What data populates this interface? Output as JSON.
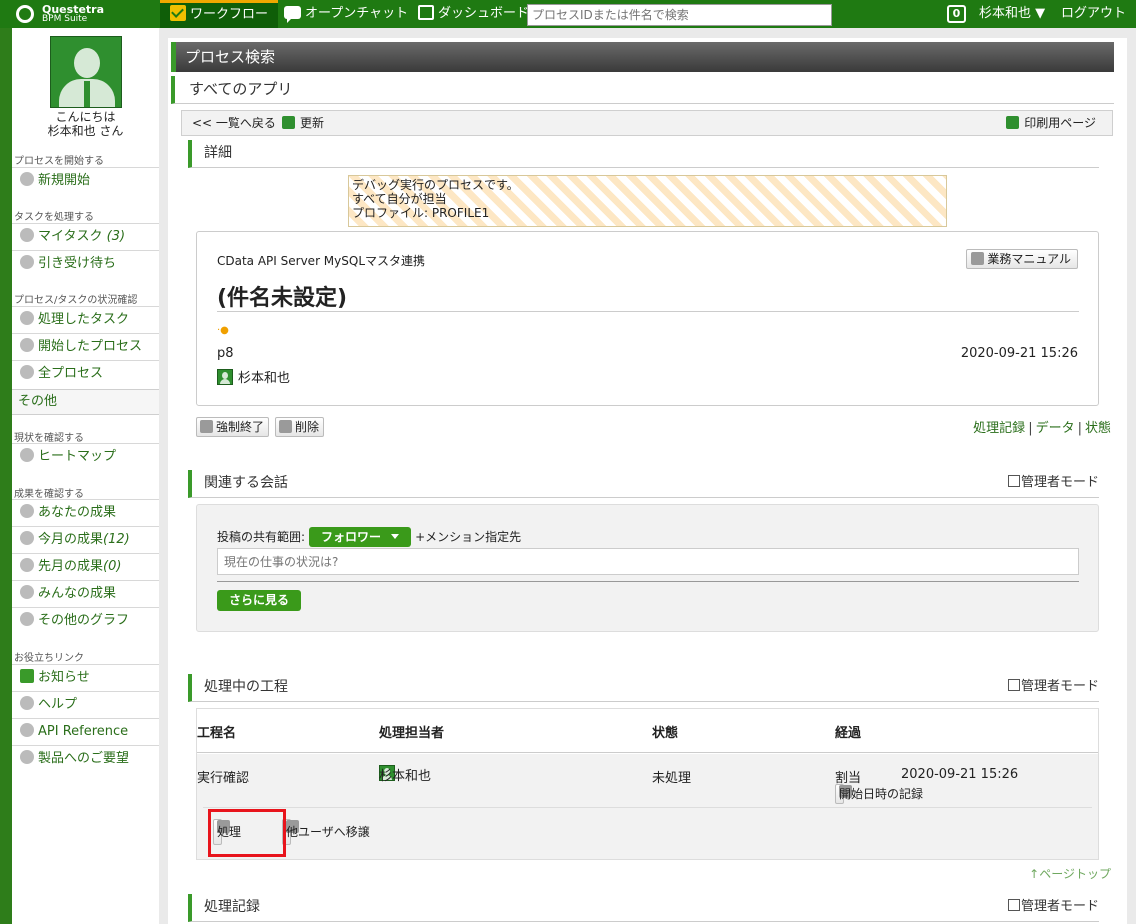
{
  "topbar": {
    "logo_line1": "Questetra",
    "logo_line2": "BPM Suite",
    "nav": {
      "workflow": "ワークフロー",
      "open_chat": "オープンチャット",
      "dashboard": "ダッシュボード"
    },
    "search_placeholder": "プロセスIDまたは件名で検索",
    "notification_count": "0",
    "user_menu": "杉本和也 ▼",
    "logout": "ログアウト"
  },
  "sidebar": {
    "greeting_line1": "こんにちは",
    "greeting_line2": "杉本和也 さん",
    "sections": {
      "start": "プロセスを開始する",
      "tasks": "タスクを処理する",
      "status": "プロセス/タスクの状況確認",
      "current": "現状を確認する",
      "results": "成果を確認する",
      "links": "お役立ちリンク"
    },
    "items": {
      "new_start": "新規開始",
      "my_tasks": "マイタスク",
      "my_tasks_count": "(3)",
      "offered": "引き受け待ち",
      "processed_tasks": "処理したタスク",
      "started_processes": "開始したプロセス",
      "all_processes": "全プロセス",
      "others": "その他",
      "heatmap": "ヒートマップ",
      "your_results": "あなたの成果",
      "this_month": "今月の成果",
      "this_month_count": "(12)",
      "last_month": "先月の成果",
      "last_month_count": "(0)",
      "everyone": "みんなの成果",
      "other_graphs": "その他のグラフ",
      "news": "お知らせ",
      "help": "ヘルプ",
      "api_reference": "API Reference",
      "feedback": "製品へのご要望"
    }
  },
  "main": {
    "title": "プロセス検索",
    "subtitle": "すべてのアプリ",
    "toolbar": {
      "back": "<< 一覧へ戻る",
      "refresh": "更新",
      "print": "印刷用ページ"
    },
    "detail": {
      "heading": "詳細",
      "debug_line1": "デバッグ実行のプロセスです。",
      "debug_line2": "すべて自分が担当",
      "debug_line3": "プロファイル: PROFILE1",
      "app_name": "CData API Server MySQLマスタ連携",
      "manual_button": "業務マニュアル",
      "subject": "(件名未設定)",
      "process_id": "p8",
      "start_datetime": "2020-09-21 15:26",
      "initiator": "杉本和也",
      "force_end_button": "強制終了",
      "delete_button": "削除",
      "links": {
        "history": "処理記録",
        "data": "データ",
        "state": "状態",
        "separator": "|"
      }
    },
    "conversation": {
      "heading": "関連する会話",
      "admin_mode": "管理者モード",
      "scope_label": "投稿の共有範囲:",
      "scope_value": "フォロワー",
      "mention": "+メンション指定先",
      "post_placeholder": "現在の仕事の状況は?",
      "more_button": "さらに見る"
    },
    "in_progress": {
      "heading": "処理中の工程",
      "admin_mode": "管理者モード",
      "columns": [
        "工程名",
        "処理担当者",
        "状態",
        "経過"
      ],
      "row": {
        "step": "実行確認",
        "assignee": "杉本和也",
        "status": "未処理",
        "elapsed_label": "割当",
        "elapsed_time": "2020-09-21 15:26",
        "record_start_button": "開始日時の記録"
      },
      "process_button": "処理",
      "transfer_button": "他ユーザへ移譲",
      "page_top": "↑ページトップ"
    },
    "history": {
      "heading": "処理記録",
      "admin_mode": "管理者モード"
    }
  }
}
